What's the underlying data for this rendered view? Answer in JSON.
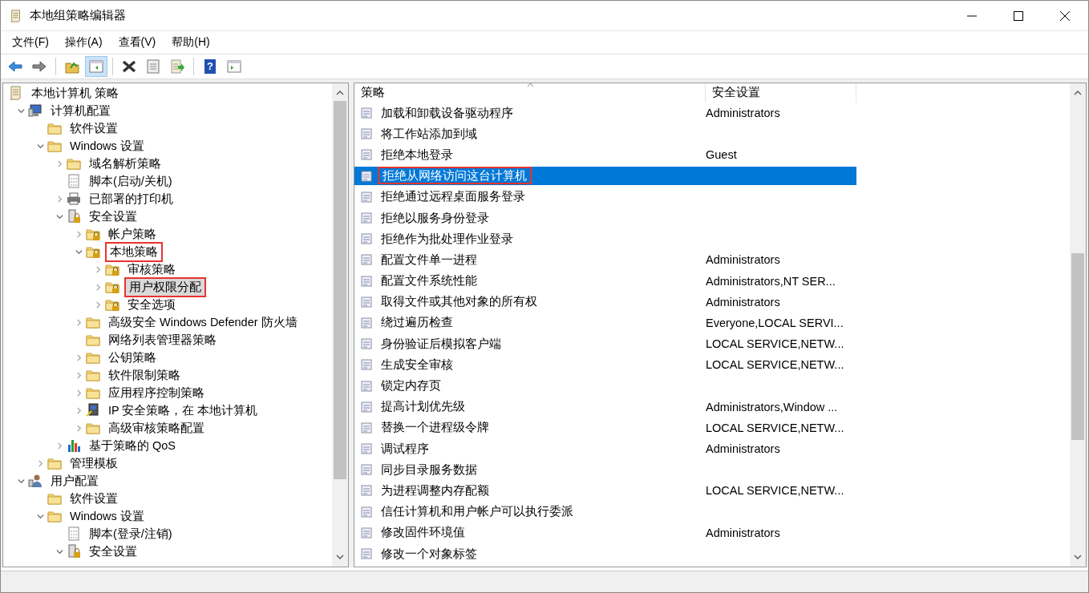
{
  "window": {
    "title": "本地组策略编辑器"
  },
  "menu": [
    "文件(F)",
    "操作(A)",
    "查看(V)",
    "帮助(H)"
  ],
  "toolbar": [
    {
      "kind": "back",
      "pressed": false
    },
    {
      "kind": "forward",
      "pressed": false
    },
    {
      "kind": "sep"
    },
    {
      "kind": "up",
      "pressed": false
    },
    {
      "kind": "tree",
      "pressed": true
    },
    {
      "kind": "sep"
    },
    {
      "kind": "delete",
      "pressed": false
    },
    {
      "kind": "properties",
      "pressed": false
    },
    {
      "kind": "export",
      "pressed": false
    },
    {
      "kind": "sep"
    },
    {
      "kind": "help",
      "label": "?",
      "pressed": false
    },
    {
      "kind": "actionpane",
      "pressed": false
    }
  ],
  "tree": [
    {
      "label": "本地计算机 策略",
      "kind": "doc",
      "selected": false,
      "annotated": false,
      "children": [
        {
          "label": "计算机配置",
          "kind": "computer",
          "expanded": true,
          "selected": false,
          "annotated": false,
          "children": [
            {
              "label": "软件设置",
              "kind": "folder",
              "selected": false,
              "annotated": false
            },
            {
              "label": "Windows 设置",
              "kind": "folder",
              "expanded": true,
              "selected": false,
              "annotated": false,
              "children": [
                {
                  "label": "域名解析策略",
                  "kind": "folder",
                  "expanded": false,
                  "selected": false,
                  "annotated": false
                },
                {
                  "label": "脚本(启动/关机)",
                  "kind": "script",
                  "selected": false,
                  "annotated": false
                },
                {
                  "label": "已部署的打印机",
                  "kind": "printer",
                  "expanded": false,
                  "selected": false,
                  "annotated": false
                },
                {
                  "label": "安全设置",
                  "kind": "security",
                  "expanded": true,
                  "selected": false,
                  "annotated": false,
                  "children": [
                    {
                      "label": "帐户策略",
                      "kind": "lockfolder",
                      "expanded": false,
                      "selected": false,
                      "annotated": false
                    },
                    {
                      "label": "本地策略",
                      "kind": "lockfolder",
                      "expanded": true,
                      "selected": false,
                      "annotated": true,
                      "children": [
                        {
                          "label": "审核策略",
                          "kind": "lockfolder",
                          "expanded": false,
                          "selected": false,
                          "annotated": false
                        },
                        {
                          "label": "用户权限分配",
                          "kind": "lockfolder",
                          "expanded": false,
                          "selected": true,
                          "annotated": true
                        },
                        {
                          "label": "安全选项",
                          "kind": "lockfolder",
                          "expanded": false,
                          "selected": false,
                          "annotated": false
                        }
                      ]
                    },
                    {
                      "label": "高级安全 Windows Defender 防火墙",
                      "kind": "folder",
                      "expanded": false,
                      "selected": false,
                      "annotated": false
                    },
                    {
                      "label": "网络列表管理器策略",
                      "kind": "folder",
                      "selected": false,
                      "annotated": false
                    },
                    {
                      "label": "公钥策略",
                      "kind": "folder",
                      "expanded": false,
                      "selected": false,
                      "annotated": false
                    },
                    {
                      "label": "软件限制策略",
                      "kind": "folder",
                      "expanded": false,
                      "selected": false,
                      "annotated": false
                    },
                    {
                      "label": "应用程序控制策略",
                      "kind": "folder",
                      "expanded": false,
                      "selected": false,
                      "annotated": false
                    },
                    {
                      "label": "IP 安全策略，在 本地计算机",
                      "kind": "ip",
                      "expanded": false,
                      "selected": false,
                      "annotated": false
                    },
                    {
                      "label": "高级审核策略配置",
                      "kind": "folder",
                      "expanded": false,
                      "selected": false,
                      "annotated": false
                    }
                  ]
                },
                {
                  "label": "基于策略的 QoS",
                  "kind": "qos",
                  "expanded": false,
                  "selected": false,
                  "annotated": false
                }
              ]
            },
            {
              "label": "管理模板",
              "kind": "folder",
              "expanded": false,
              "selected": false,
              "annotated": false
            }
          ]
        },
        {
          "label": "用户配置",
          "kind": "user",
          "expanded": true,
          "selected": false,
          "annotated": false,
          "children": [
            {
              "label": "软件设置",
              "kind": "folder",
              "selected": false,
              "annotated": false
            },
            {
              "label": "Windows 设置",
              "kind": "folder",
              "expanded": true,
              "selected": false,
              "annotated": false,
              "children": [
                {
                  "label": "脚本(登录/注销)",
                  "kind": "script",
                  "selected": false,
                  "annotated": false
                },
                {
                  "label": "安全设置",
                  "kind": "security",
                  "expanded": true,
                  "selected": false,
                  "annotated": false
                }
              ]
            }
          ]
        }
      ]
    }
  ],
  "table": {
    "columns": [
      "策略",
      "安全设置"
    ],
    "rows": [
      {
        "policy": "加载和卸载设备驱动程序",
        "setting": "Administrators",
        "selected": false,
        "annotated": false
      },
      {
        "policy": "将工作站添加到域",
        "selected": false,
        "annotated": false
      },
      {
        "policy": "拒绝本地登录",
        "setting": "Guest",
        "selected": false,
        "annotated": false
      },
      {
        "policy": "拒绝从网络访问这台计算机",
        "selected": true,
        "annotated": true
      },
      {
        "policy": "拒绝通过远程桌面服务登录",
        "selected": false,
        "annotated": false
      },
      {
        "policy": "拒绝以服务身份登录",
        "selected": false,
        "annotated": false
      },
      {
        "policy": "拒绝作为批处理作业登录",
        "selected": false,
        "annotated": false
      },
      {
        "policy": "配置文件单一进程",
        "setting": "Administrators",
        "selected": false,
        "annotated": false
      },
      {
        "policy": "配置文件系统性能",
        "setting": "Administrators,NT SER...",
        "selected": false,
        "annotated": false
      },
      {
        "policy": "取得文件或其他对象的所有权",
        "setting": "Administrators",
        "selected": false,
        "annotated": false
      },
      {
        "policy": "绕过遍历检查",
        "setting": "Everyone,LOCAL SERVI...",
        "selected": false,
        "annotated": false
      },
      {
        "policy": "身份验证后模拟客户端",
        "setting": "LOCAL SERVICE,NETW...",
        "selected": false,
        "annotated": false
      },
      {
        "policy": "生成安全审核",
        "setting": "LOCAL SERVICE,NETW...",
        "selected": false,
        "annotated": false
      },
      {
        "policy": "锁定内存页",
        "selected": false,
        "annotated": false
      },
      {
        "policy": "提高计划优先级",
        "setting": "Administrators,Window ...",
        "selected": false,
        "annotated": false
      },
      {
        "policy": "替换一个进程级令牌",
        "setting": "LOCAL SERVICE,NETW...",
        "selected": false,
        "annotated": false
      },
      {
        "policy": "调试程序",
        "setting": "Administrators",
        "selected": false,
        "annotated": false
      },
      {
        "policy": "同步目录服务数据",
        "selected": false,
        "annotated": false
      },
      {
        "policy": "为进程调整内存配额",
        "setting": "LOCAL SERVICE,NETW...",
        "selected": false,
        "annotated": false
      },
      {
        "policy": "信任计算机和用户帐户可以执行委派",
        "selected": false,
        "annotated": false
      },
      {
        "policy": "修改固件环境值",
        "setting": "Administrators",
        "selected": false,
        "annotated": false
      },
      {
        "policy": "修改一个对象标签",
        "selected": false,
        "annotated": false
      }
    ]
  }
}
